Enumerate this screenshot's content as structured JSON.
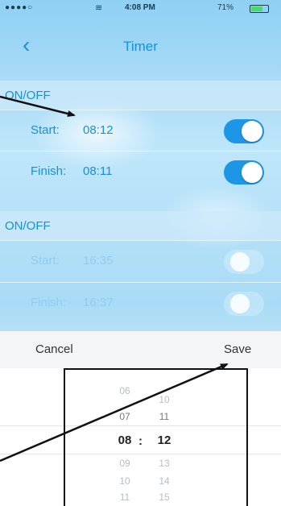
{
  "status_bar": {
    "signal": "●●●●○",
    "time": "4:08 PM",
    "battery": "71%"
  },
  "nav": {
    "title": "Timer"
  },
  "groups": [
    {
      "header": "ON/OFF",
      "start_label": "Start:",
      "start_time": "08:12",
      "finish_label": "Finish:",
      "finish_time": "08:11",
      "start_on": true,
      "finish_on": true
    },
    {
      "header": "ON/OFF",
      "start_label": "Start:",
      "start_time": "16:35",
      "finish_label": "Finish:",
      "finish_time": "16:37",
      "start_on": false,
      "finish_on": false
    }
  ],
  "actions": {
    "cancel": "Cancel",
    "save": "Save"
  },
  "picker": {
    "hours": [
      "06",
      "07",
      "08",
      "09",
      "10",
      "11"
    ],
    "minutes": [
      "10",
      "11",
      "12",
      "13",
      "14",
      "15"
    ],
    "selected_hour": "08",
    "selected_minute": "12",
    "separator": ":"
  },
  "colors": {
    "accent": "#1b8fd6",
    "toggle_on": "#1e96e6"
  }
}
